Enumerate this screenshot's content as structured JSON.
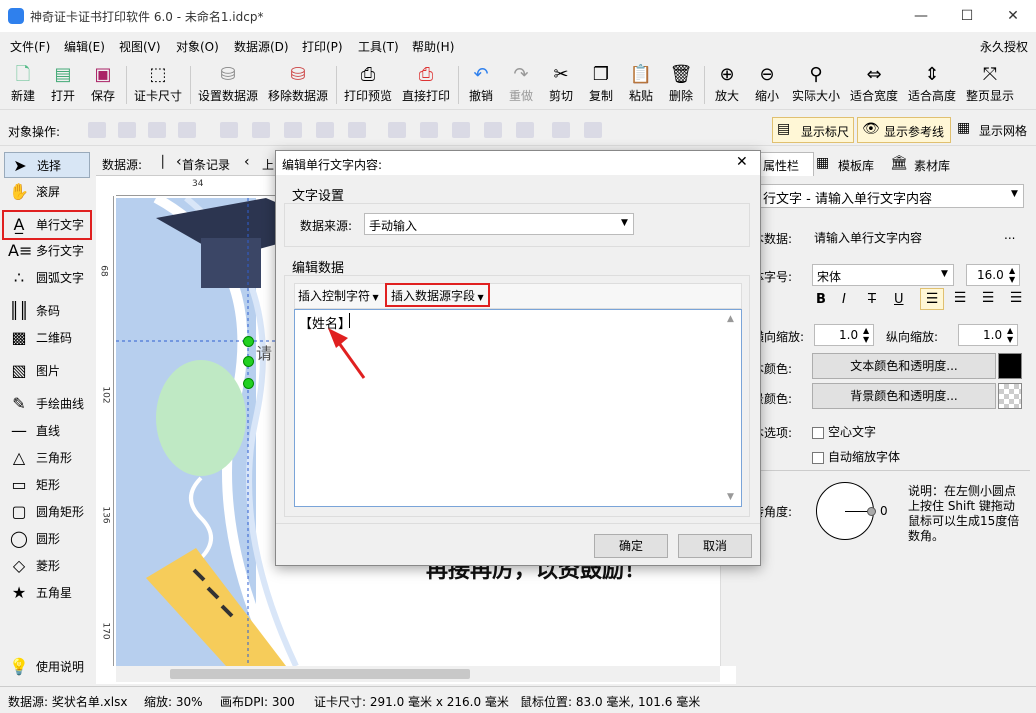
{
  "window": {
    "title": "神奇证卡证书打印软件 6.0 - 未命名1.idcp*",
    "min": "—",
    "max": "☐",
    "close": "✕"
  },
  "menu": [
    "文件(F)",
    "编辑(E)",
    "视图(V)",
    "对象(O)",
    "数据源(D)",
    "打印(P)",
    "工具(T)",
    "帮助(H)"
  ],
  "menu_right": "永久授权",
  "toolbar": [
    "新建",
    "打开",
    "保存",
    "证卡尺寸",
    "设置数据源",
    "移除数据源",
    "打印预览",
    "直接打印",
    "撤销",
    "重做",
    "剪切",
    "复制",
    "粘贴",
    "删除",
    "放大",
    "缩小",
    "实际大小",
    "适合宽度",
    "适合高度",
    "整页显示"
  ],
  "objbar": {
    "label": "对象操作:",
    "ruler": "显示标尺",
    "guides": "显示参考线",
    "grid": "显示网格"
  },
  "tools": [
    "选择",
    "滚屏",
    "单行文字",
    "多行文字",
    "圆弧文字",
    "条码",
    "二维码",
    "图片",
    "手绘曲线",
    "直线",
    "三角形",
    "矩形",
    "圆角矩形",
    "圆形",
    "菱形",
    "五角星",
    "使用说明"
  ],
  "datasource_bar": {
    "label": "数据源:",
    "first": "首条记录",
    "prev": "上"
  },
  "ruler_h": [
    "34"
  ],
  "ruler_v": [
    "68",
    "102",
    "136",
    "170"
  ],
  "canvas_text": {
    "partial": "请",
    "motto": "再接再厉，以资鼓励！"
  },
  "right_tabs": [
    "属性栏",
    "模板库",
    "素材库"
  ],
  "props": {
    "object": "行文字 - 请输入单行文字内容",
    "data_label": "本数据:",
    "data_value": "请输入单行文字内容",
    "data_btn": "...",
    "font_label": "体字号:",
    "font": "宋体",
    "size": "16.0",
    "hscale_label": "横向缩放:",
    "hscale": "1.0",
    "vscale_label": "纵向缩放:",
    "vscale": "1.0",
    "textcolor_label": "本颜色:",
    "textcolor_btn": "文本颜色和透明度...",
    "bgcolor_label": "景颜色:",
    "bgcolor_btn": "背景颜色和透明度...",
    "options_label": "本选项:",
    "hollow": "空心文字",
    "autoscale": "自动缩放字体",
    "rotate_label": "转角度:",
    "rotate_value": "0",
    "note": "说明：在左侧小圆点上按住 Shift 键拖动鼠标可以生成15度倍数角。",
    "format": [
      "B",
      "I",
      "T",
      "U"
    ]
  },
  "dialog": {
    "title": "编辑单行文字内容:",
    "close": "✕",
    "text_settings": "文字设置",
    "source_label": "数据来源:",
    "source_value": "手动输入",
    "edit_data": "编辑数据",
    "insert_ctrl": "插入控制字符",
    "insert_field": "插入数据源字段",
    "content": "【姓名】",
    "ok": "确定",
    "cancel": "取消"
  },
  "status": {
    "datasource": "数据源: 奖状名单.xlsx",
    "zoom": "缩放: 30%",
    "dpi": "画布DPI: 300",
    "size": "证卡尺寸: 291.0 毫米 x 216.0 毫米",
    "mouse": "鼠标位置: 83.0 毫米, 101.6 毫米"
  },
  "colors": {
    "accent": "#2f80ed",
    "highlight": "#e02020",
    "canvas_bg": "#b7cfee"
  }
}
